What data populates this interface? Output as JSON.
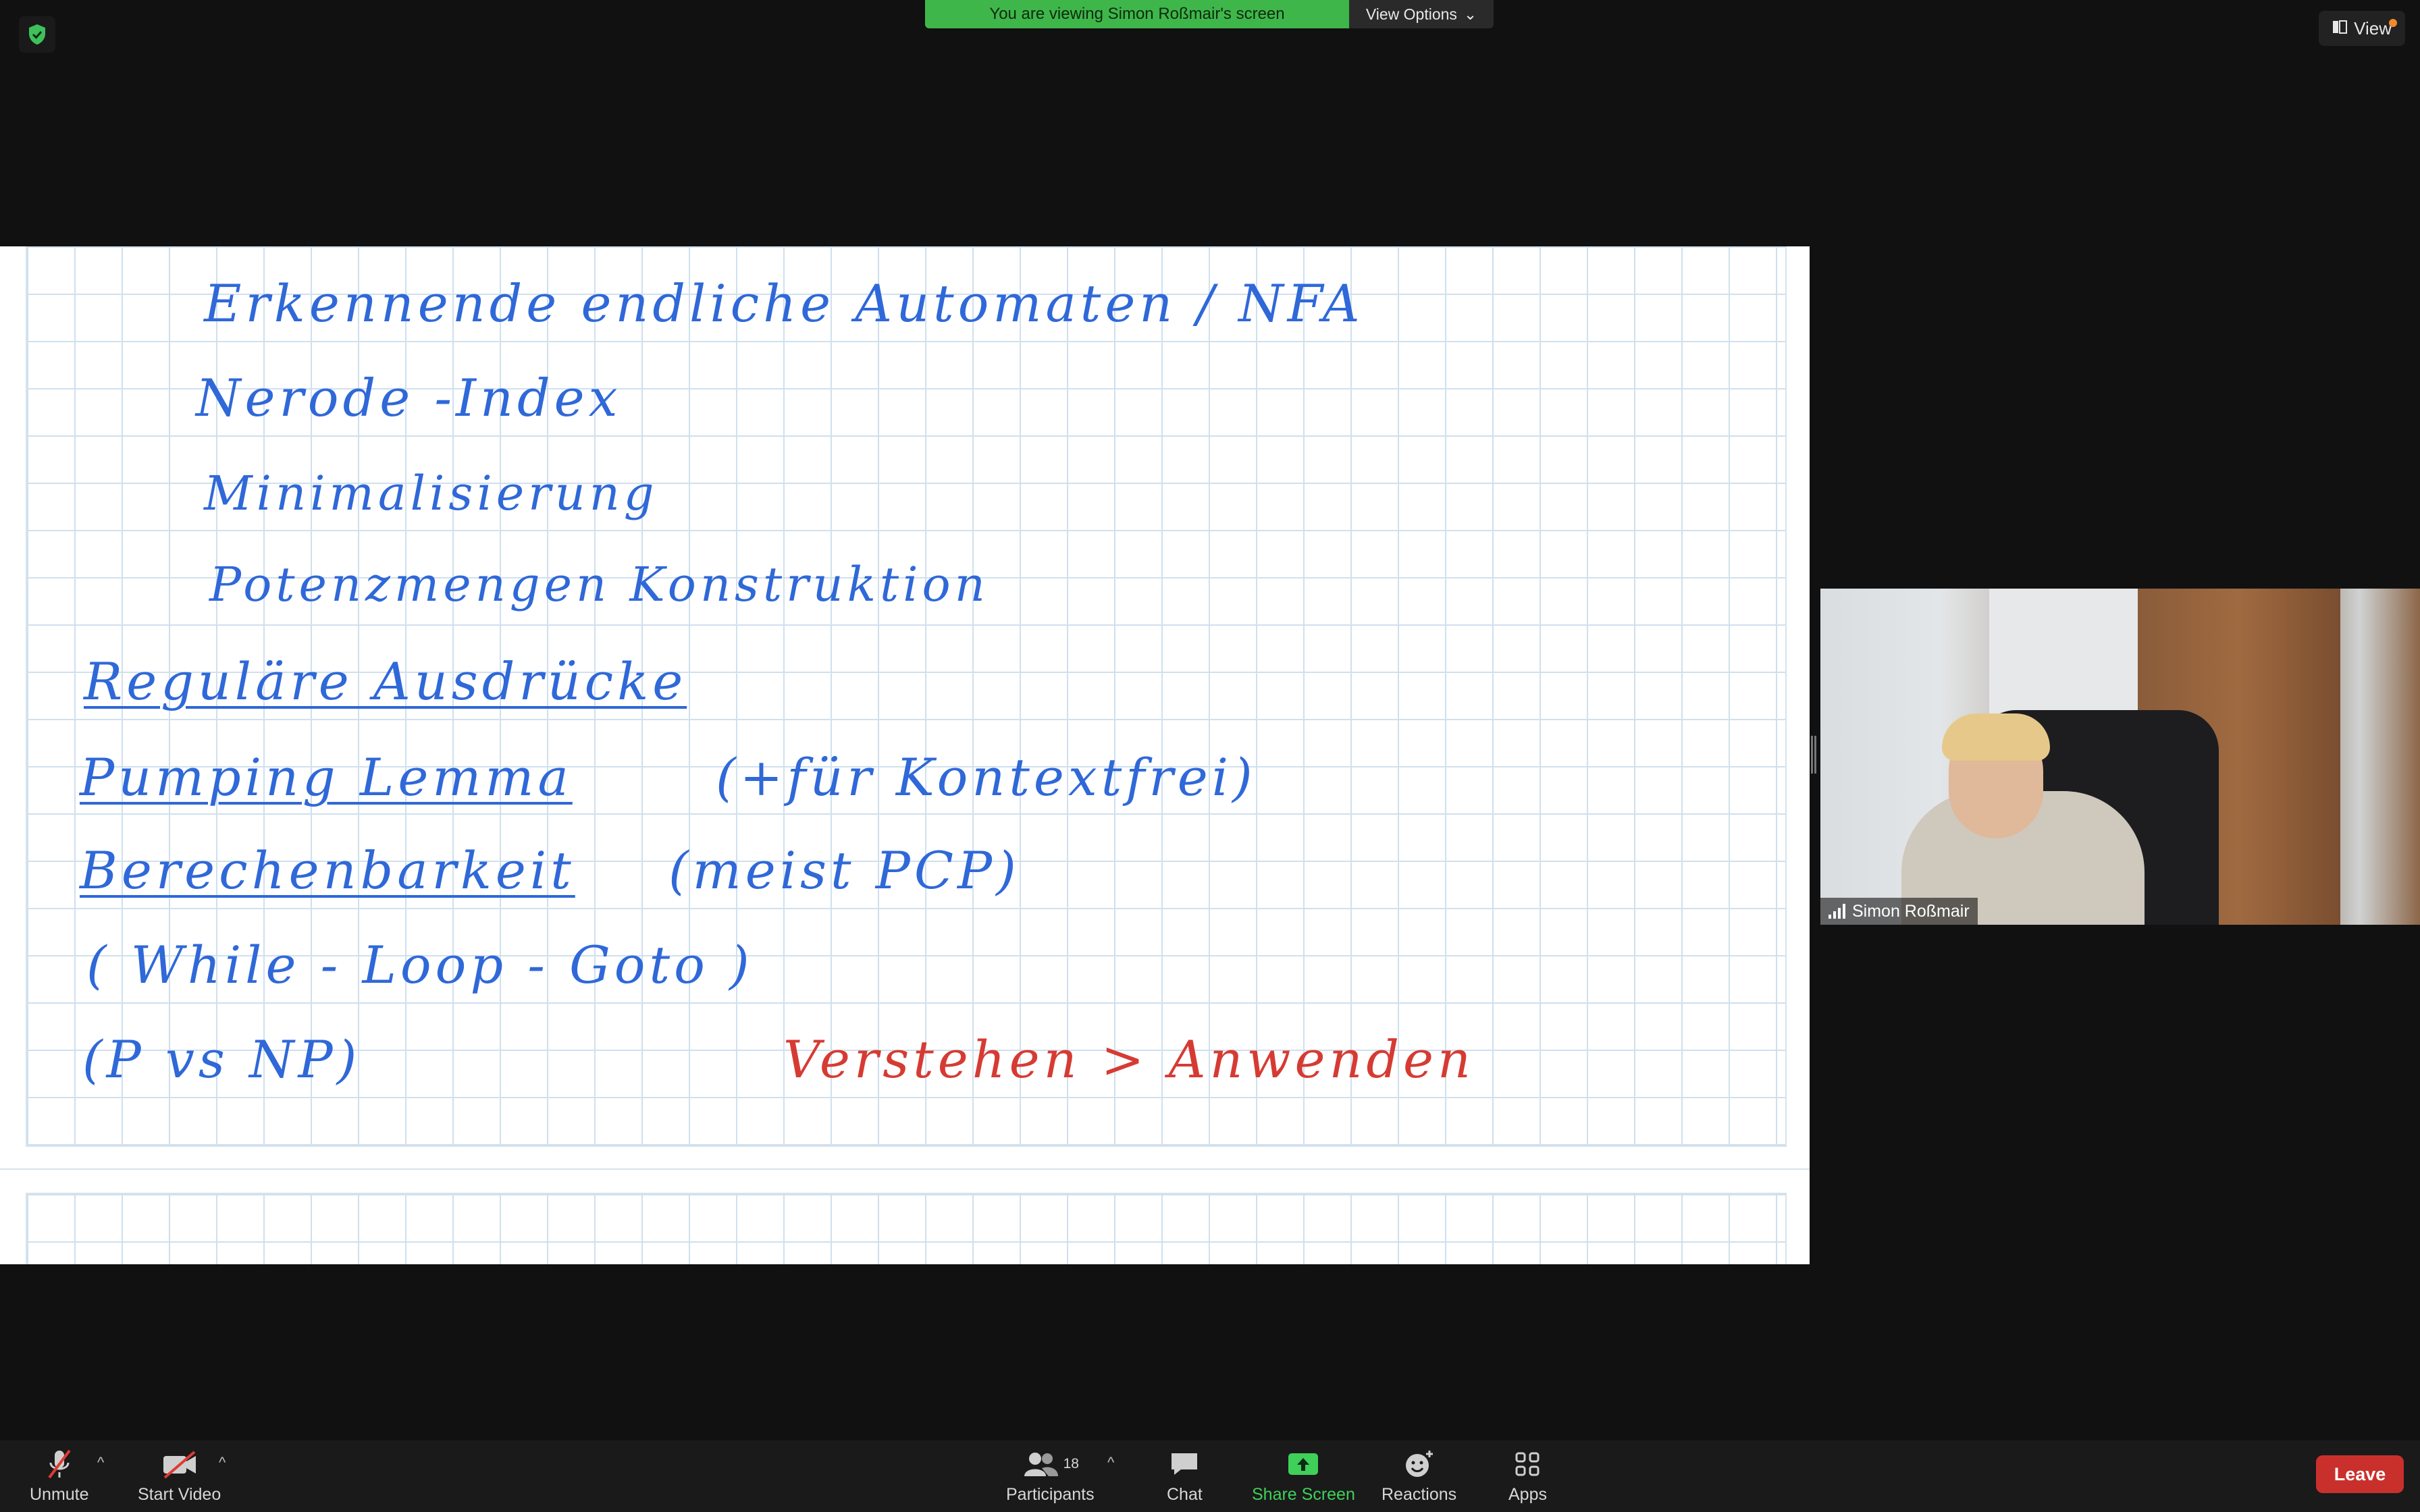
{
  "top": {
    "banner_text": "You are viewing Simon Roßmair's screen",
    "view_options_label": "View Options",
    "view_label": "View"
  },
  "notes": {
    "lines": [
      "Erkennende endliche Automaten / NFA",
      "Nerode -Index",
      "Minimalisierung",
      "Potenzmengen Konstruktion",
      "Reguläre Ausdrücke",
      "Pumping Lemma",
      "(+für Kontextfrei)",
      "Berechenbarkeit",
      "(meist PCP)",
      "( While - Loop - Goto )",
      "(P vs NP)",
      "Verstehen > Anwenden"
    ]
  },
  "video": {
    "participant_name": "Simon Roßmair"
  },
  "toolbar": {
    "unmute_label": "Unmute",
    "start_video_label": "Start Video",
    "participants_label": "Participants",
    "participants_count": "18",
    "chat_label": "Chat",
    "share_screen_label": "Share Screen",
    "reactions_label": "Reactions",
    "apps_label": "Apps",
    "leave_label": "Leave"
  },
  "colors": {
    "ink_blue": "#2f68d8",
    "ink_red": "#d63b33",
    "banner_green": "#3fb64a",
    "leave_red": "#c9302c"
  }
}
